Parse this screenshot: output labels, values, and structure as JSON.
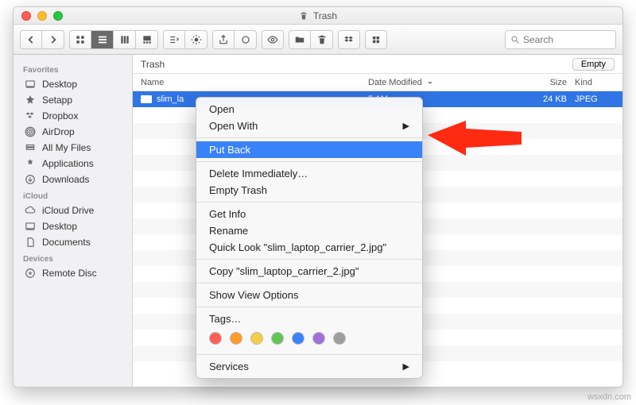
{
  "window": {
    "title": "Trash"
  },
  "toolbar": {
    "search_placeholder": "Search"
  },
  "sidebar": {
    "sections": [
      {
        "heading": "Favorites",
        "items": [
          {
            "label": "Desktop",
            "name": "sidebar-item-desktop"
          },
          {
            "label": "Setapp",
            "name": "sidebar-item-setapp"
          },
          {
            "label": "Dropbox",
            "name": "sidebar-item-dropbox"
          },
          {
            "label": "AirDrop",
            "name": "sidebar-item-airdrop"
          },
          {
            "label": "All My Files",
            "name": "sidebar-item-all-my-files"
          },
          {
            "label": "Applications",
            "name": "sidebar-item-applications"
          },
          {
            "label": "Downloads",
            "name": "sidebar-item-downloads"
          }
        ]
      },
      {
        "heading": "iCloud",
        "items": [
          {
            "label": "iCloud Drive",
            "name": "sidebar-item-icloud-drive"
          },
          {
            "label": "Desktop",
            "name": "sidebar-item-icloud-desktop"
          },
          {
            "label": "Documents",
            "name": "sidebar-item-documents"
          }
        ]
      },
      {
        "heading": "Devices",
        "items": [
          {
            "label": "Remote Disc",
            "name": "sidebar-item-remote-disc"
          }
        ]
      }
    ]
  },
  "pathbar": {
    "location": "Trash",
    "empty_label": "Empty"
  },
  "columns": {
    "name": "Name",
    "date": "Date Modified",
    "size": "Size",
    "kind": "Kind"
  },
  "file": {
    "name_visible": "slim_la",
    "date_visible": "5 AM",
    "size": "24 KB",
    "kind": "JPEG"
  },
  "context_menu": {
    "open": "Open",
    "open_with": "Open With",
    "put_back": "Put Back",
    "delete_immediately": "Delete Immediately…",
    "empty_trash": "Empty Trash",
    "get_info": "Get Info",
    "rename": "Rename",
    "quick_look": "Quick Look \"slim_laptop_carrier_2.jpg\"",
    "copy": "Copy \"slim_laptop_carrier_2.jpg\"",
    "show_view_options": "Show View Options",
    "tags": "Tags…",
    "services": "Services",
    "tag_colors": [
      "#ff5f57",
      "#fd9b2b",
      "#f7cd46",
      "#62c554",
      "#3a82f7",
      "#a070d8",
      "#9e9e9e"
    ]
  },
  "watermark": "wsxdn.com"
}
